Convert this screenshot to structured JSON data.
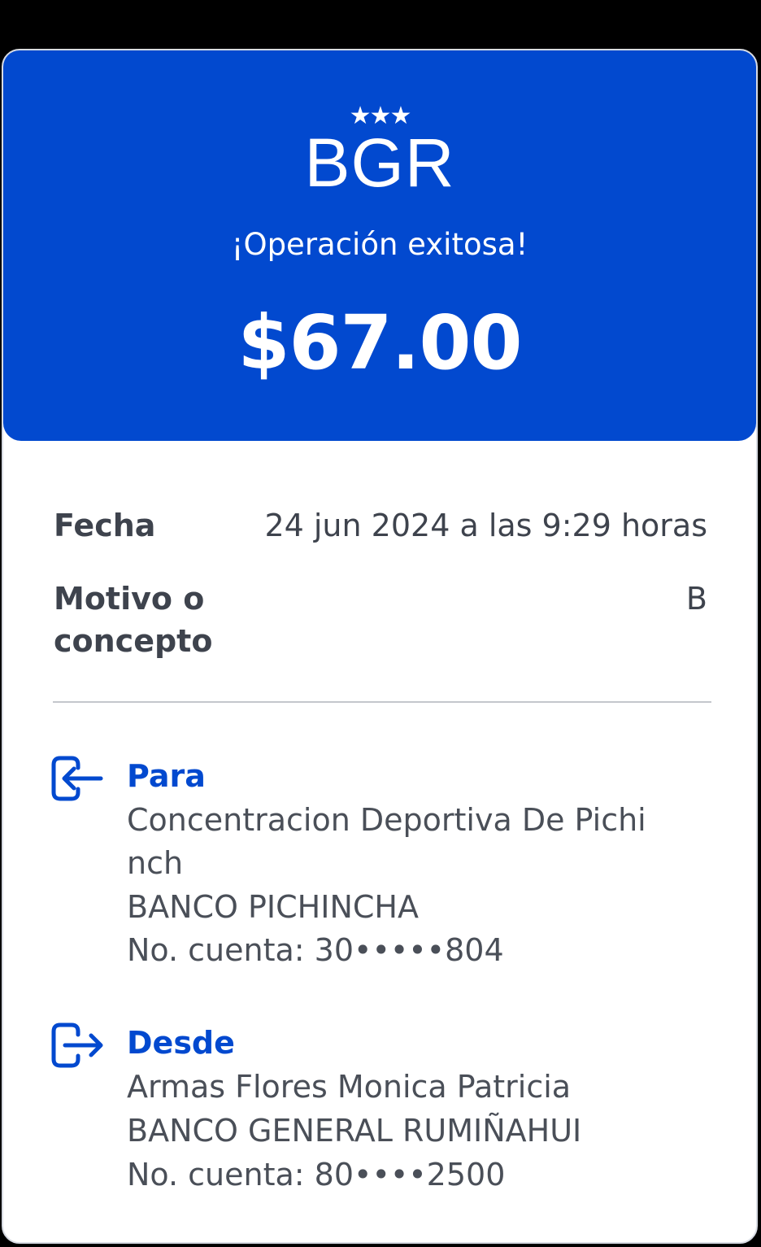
{
  "header": {
    "stars": "★★★",
    "logo": "BGR",
    "status": "¡Operación exitosa!",
    "amount": "$67.00"
  },
  "details": {
    "fecha_label": "Fecha",
    "fecha_value": "24 jun 2024 a las 9:29 horas",
    "motivo_label_line1": "Motivo o",
    "motivo_label_line2": "concepto",
    "motivo_value": "B"
  },
  "para": {
    "icon": "arrow-into-box-icon",
    "title": "Para",
    "name_line1": "Concentracion Deportiva De Pichi",
    "name_line2": "nch",
    "bank": "BANCO PICHINCHA",
    "account": "No. cuenta: 30•••••804"
  },
  "desde": {
    "icon": "arrow-out-of-box-icon",
    "title": "Desde",
    "name": "Armas Flores Monica Patricia",
    "bank": "BANCO GENERAL RUMIÑAHUI",
    "account": "No. cuenta: 80••••2500"
  },
  "colors": {
    "brand_blue": "#0249cf",
    "text_dark": "#3e434d",
    "divider": "#c4c7cc"
  }
}
